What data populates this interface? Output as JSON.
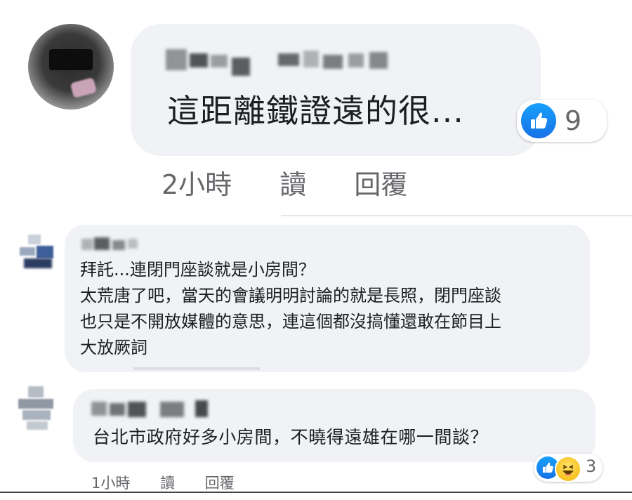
{
  "comments": [
    {
      "text": "這距離鐵證遠的很...",
      "meta": {
        "time": "2小時",
        "read": "讀",
        "reply": "回覆"
      },
      "reaction_count": "9",
      "reaction_icons": [
        "like-icon"
      ]
    },
    {
      "text": "拜託...連閉門座談就是小房間？\n太荒唐了吧，當天的會議明明討論的就是長照，閉門座談\n也只是不開放媒體的意思，連這個都沒搞懂還敢在節目上\n大放厥詞",
      "reaction_icons": []
    },
    {
      "text": "台北市政府好多小房間，不曉得遠雄在哪一間談？",
      "meta": {
        "time": "1小時",
        "read": "讀",
        "reply": "回覆"
      },
      "reaction_count": "3",
      "reaction_icons": [
        "like-icon",
        "haha-icon"
      ]
    }
  ],
  "colors": {
    "bubble": "#f0f2f5",
    "meta_text": "#65676b",
    "like_blue": "#1877f2"
  }
}
